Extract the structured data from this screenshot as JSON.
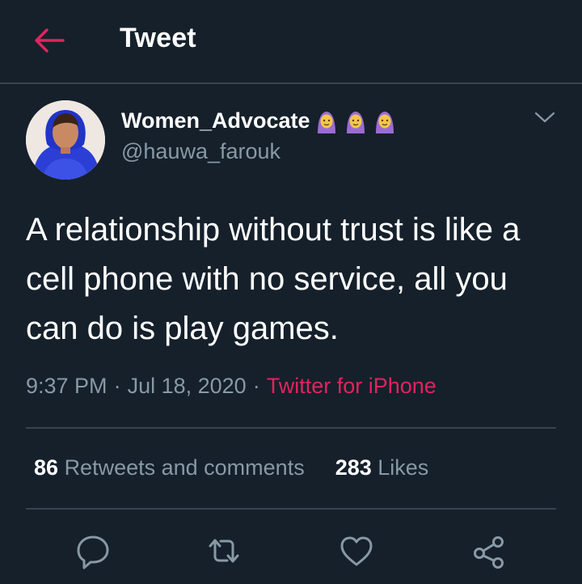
{
  "header": {
    "title": "Tweet"
  },
  "user": {
    "display_name": "Women_Advocate",
    "handle": "@hauwa_farouk",
    "name_emojis": [
      "🧕",
      "🧕",
      "🧕"
    ]
  },
  "tweet": {
    "text": "A relationship without trust is like a cell phone with no service, all you can do is play games.",
    "time": "9:37 PM",
    "date": "Jul 18, 2020",
    "separator": "·",
    "source": "Twitter for iPhone"
  },
  "stats": {
    "retweets_count": "86",
    "retweets_label": "Retweets and comments",
    "likes_count": "283",
    "likes_label": "Likes"
  },
  "colors": {
    "background": "#15202b",
    "accent": "#e0245e",
    "secondary_text": "#8899a6",
    "divider": "#38444d"
  },
  "icons": {
    "back": "back-arrow-icon",
    "more": "chevron-down-icon",
    "reply": "reply-icon",
    "retweet": "retweet-icon",
    "like": "heart-icon",
    "share": "share-icon"
  }
}
